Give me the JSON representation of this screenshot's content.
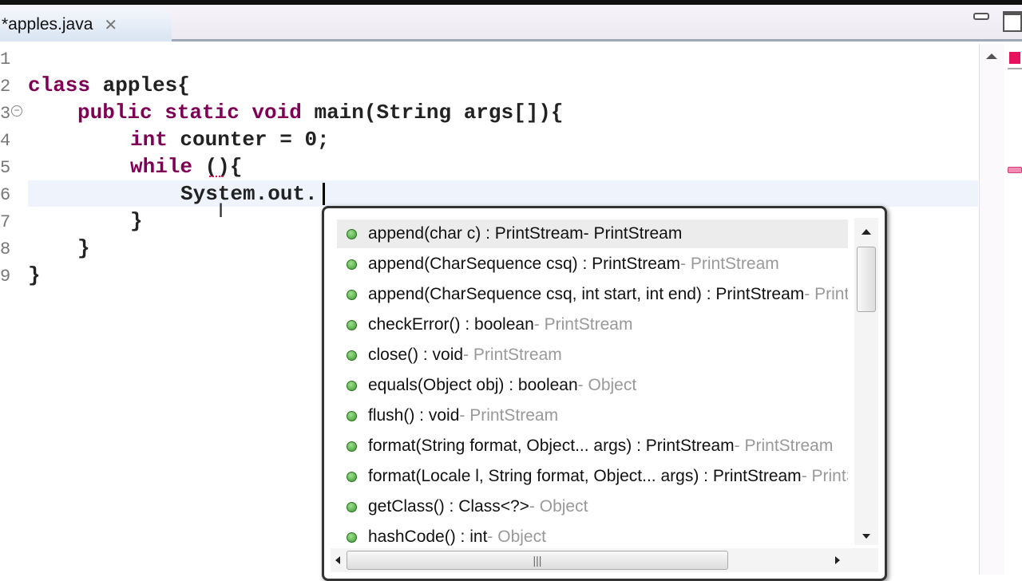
{
  "tab": {
    "title": "*apples.java",
    "close": "✕"
  },
  "gutter": [
    "1",
    "2",
    "3",
    "4",
    "5",
    "6",
    "7",
    "8",
    "9"
  ],
  "code": {
    "l2": {
      "kw": "class",
      "rest": " apples{"
    },
    "l3": {
      "kw": "public static void",
      "rest": " main(String args[]){"
    },
    "l4": {
      "kw": "int",
      "rest": " counter = 0;"
    },
    "l5": {
      "kw": "while",
      "rest": " (){"
    },
    "l6": "System.out.",
    "l7": "}",
    "l8": "}",
    "l9": "}"
  },
  "completions": [
    {
      "sig": "append(char c) : PrintStream",
      "owner": " - PrintStream"
    },
    {
      "sig": "append(CharSequence csq) : PrintStream",
      "owner": " - PrintStream"
    },
    {
      "sig": "append(CharSequence csq, int start, int end) : PrintStream",
      "owner": " - PrintStream"
    },
    {
      "sig": "checkError() : boolean",
      "owner": " - PrintStream"
    },
    {
      "sig": "close() : void",
      "owner": " - PrintStream"
    },
    {
      "sig": "equals(Object obj) : boolean",
      "owner": " - Object"
    },
    {
      "sig": "flush() : void",
      "owner": " - PrintStream"
    },
    {
      "sig": "format(String format, Object... args) : PrintStream",
      "owner": " - PrintStream"
    },
    {
      "sig": "format(Locale l, String format, Object... args) : PrintStream",
      "owner": " - PrintStream"
    },
    {
      "sig": "getClass() : Class<?>",
      "owner": " - Object"
    },
    {
      "sig": "hashCode() : int",
      "owner": " - Object"
    }
  ],
  "colors": {
    "keyword": "#7f0055",
    "error_marker": "#e8115b"
  }
}
